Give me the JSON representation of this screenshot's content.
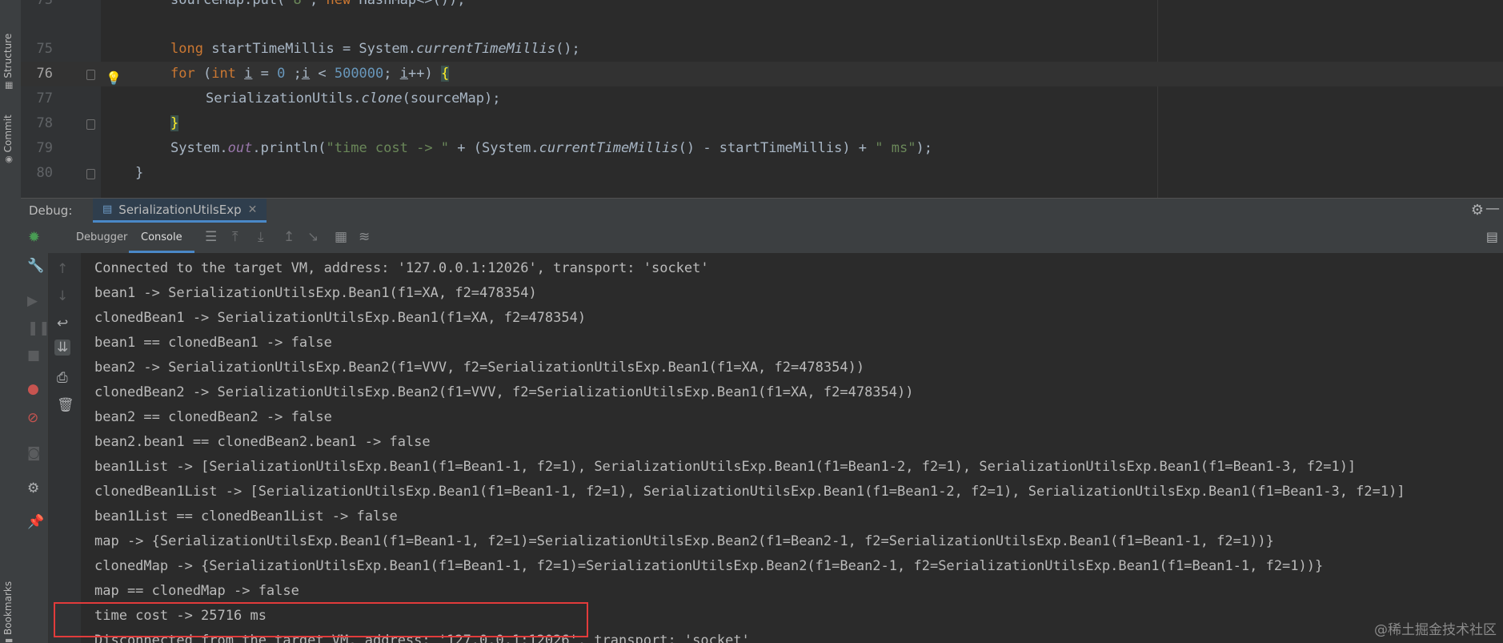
{
  "left_stripe": {
    "structure_label": "Structure",
    "commit_label": "Commit",
    "bookmarks_label": "Bookmarks"
  },
  "editor": {
    "lines": [
      {
        "num": "75",
        "code": "long startTimeMillis = System.currentTimeMillis();"
      },
      {
        "num": "76",
        "code": "for (int i = 0 ;i < 500000; i++) {"
      },
      {
        "num": "77",
        "code": "SerializationUtils.clone(sourceMap);"
      },
      {
        "num": "78",
        "code": "}"
      },
      {
        "num": "79",
        "code": "System.out.println(\"time cost -> \" + (System.currentTimeMillis() - startTimeMillis) + \" ms\");"
      },
      {
        "num": "80",
        "code": "}"
      }
    ],
    "partial_top_line": {
      "num": "73",
      "code": "sourceMap.put(\"8\", new HashMap<>());"
    },
    "current_line": "76"
  },
  "debug_panel": {
    "label": "Debug:",
    "run_tab": "SerializationUtilsExp",
    "tabs": [
      "Debugger",
      "Console"
    ],
    "active_tab": "Console"
  },
  "console": {
    "lines": [
      "Connected to the target VM, address: '127.0.0.1:12026', transport: 'socket'",
      "bean1 -> SerializationUtilsExp.Bean1(f1=XA, f2=478354)",
      "clonedBean1 -> SerializationUtilsExp.Bean1(f1=XA, f2=478354)",
      "bean1 == clonedBean1 -> false",
      "bean2 -> SerializationUtilsExp.Bean2(f1=VVV, f2=SerializationUtilsExp.Bean1(f1=XA, f2=478354))",
      "clonedBean2 -> SerializationUtilsExp.Bean2(f1=VVV, f2=SerializationUtilsExp.Bean1(f1=XA, f2=478354))",
      "bean2 == clonedBean2 -> false",
      "bean2.bean1 == clonedBean2.bean1 -> false",
      "bean1List -> [SerializationUtilsExp.Bean1(f1=Bean1-1, f2=1), SerializationUtilsExp.Bean1(f1=Bean1-2, f2=1), SerializationUtilsExp.Bean1(f1=Bean1-3, f2=1)]",
      "clonedBean1List -> [SerializationUtilsExp.Bean1(f1=Bean1-1, f2=1), SerializationUtilsExp.Bean1(f1=Bean1-2, f2=1), SerializationUtilsExp.Bean1(f1=Bean1-3, f2=1)]",
      "bean1List == clonedBean1List -> false",
      "map -> {SerializationUtilsExp.Bean1(f1=Bean1-1, f2=1)=SerializationUtilsExp.Bean2(f1=Bean2-1, f2=SerializationUtilsExp.Bean1(f1=Bean1-1, f2=1))}",
      "clonedMap -> {SerializationUtilsExp.Bean1(f1=Bean1-1, f2=1)=SerializationUtilsExp.Bean2(f1=Bean2-1, f2=SerializationUtilsExp.Bean1(f1=Bean1-1, f2=1))}",
      "map == clonedMap -> false",
      "time cost -> 25716 ms",
      "Disconnected from the target VM, address: '127.0.0.1:12026', transport: 'socket'"
    ]
  },
  "watermark": "@稀土掘金技术社区",
  "colors": {
    "background": "#2b2b2b",
    "keyword": "#cc7832",
    "number": "#6897bb",
    "string": "#6a8759",
    "highlight_box": "#e23b3b"
  }
}
